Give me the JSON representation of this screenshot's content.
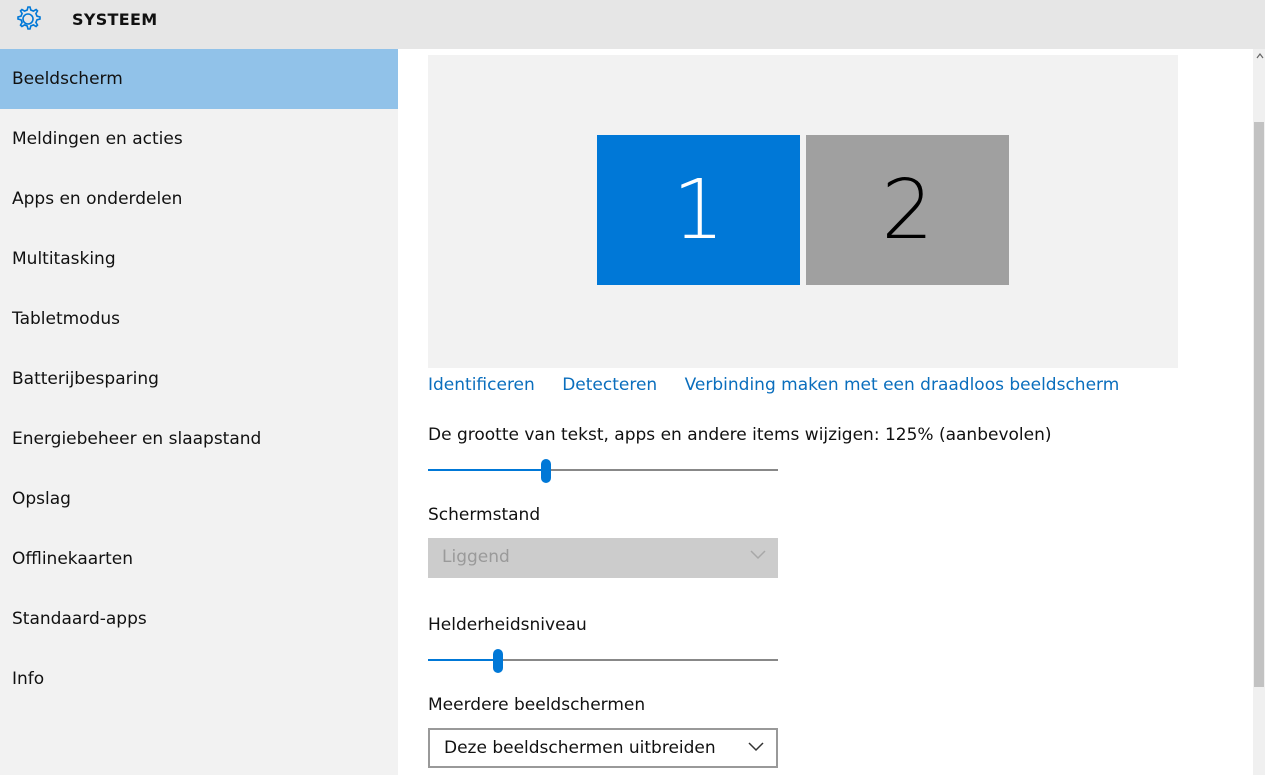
{
  "app": {
    "title": "SYSTEEM",
    "icon": "gear-icon"
  },
  "sidebar": {
    "items": [
      {
        "label": "Beeldscherm",
        "active": true
      },
      {
        "label": "Meldingen en acties"
      },
      {
        "label": "Apps en onderdelen"
      },
      {
        "label": "Multitasking"
      },
      {
        "label": "Tabletmodus"
      },
      {
        "label": "Batterijbesparing"
      },
      {
        "label": "Energiebeheer en slaapstand"
      },
      {
        "label": "Opslag"
      },
      {
        "label": "Offlinekaarten"
      },
      {
        "label": "Standaard-apps"
      },
      {
        "label": "Info"
      }
    ]
  },
  "display": {
    "monitors": [
      {
        "number": "1",
        "color": "#0078d7"
      },
      {
        "number": "2",
        "color": "#a0a0a0"
      }
    ],
    "links": {
      "identify": "Identificeren",
      "detect": "Detecteren",
      "wireless": "Verbinding maken met een draadloos beeldscherm"
    },
    "scale": {
      "label": "De grootte van tekst, apps en andere items wijzigen:  125% (aanbevolen)",
      "value_fraction": 0.337
    },
    "orientation": {
      "label": "Schermstand",
      "value": "Liggend",
      "disabled": true
    },
    "brightness": {
      "label": "Helderheidsniveau",
      "value_fraction": 0.2
    },
    "multiple": {
      "label": "Meerdere beeldschermen",
      "value": "Deze beeldschermen uitbreiden"
    }
  },
  "colors": {
    "accent": "#0078d7",
    "link": "#0a6ebd",
    "selected_nav": "#91c2e9"
  }
}
